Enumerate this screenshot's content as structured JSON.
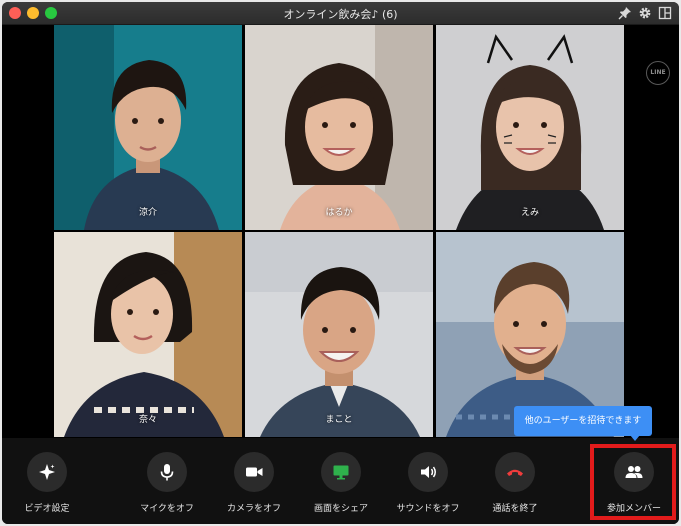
{
  "window": {
    "title": "オンライン飲み会♪ (6)"
  },
  "titlebar_icons": [
    "pin-icon",
    "gear-icon",
    "layout-icon"
  ],
  "participants": [
    {
      "name": "涼介"
    },
    {
      "name": "はるか"
    },
    {
      "name": "えみ"
    },
    {
      "name": "奈々"
    },
    {
      "name": "まこと"
    },
    {
      "name": ""
    }
  ],
  "watermark": "LINE",
  "tooltip": {
    "text": "他のユーザーを招待できます"
  },
  "controls": [
    {
      "label": "ビデオ設定",
      "icon": "sparkle-icon"
    },
    {
      "label": "マイクをオフ",
      "icon": "microphone-icon"
    },
    {
      "label": "カメラをオフ",
      "icon": "video-camera-icon"
    },
    {
      "label": "画面をシェア",
      "icon": "screen-share-icon"
    },
    {
      "label": "サウンドをオフ",
      "icon": "speaker-icon"
    },
    {
      "label": "通話を終了",
      "icon": "end-call-icon"
    },
    {
      "label": "参加メンバー",
      "icon": "members-icon"
    }
  ],
  "colors": {
    "accent": "#3d8ff5",
    "highlight": "#e21b1b",
    "share": "#2fb24c",
    "end": "#f03c3c"
  }
}
